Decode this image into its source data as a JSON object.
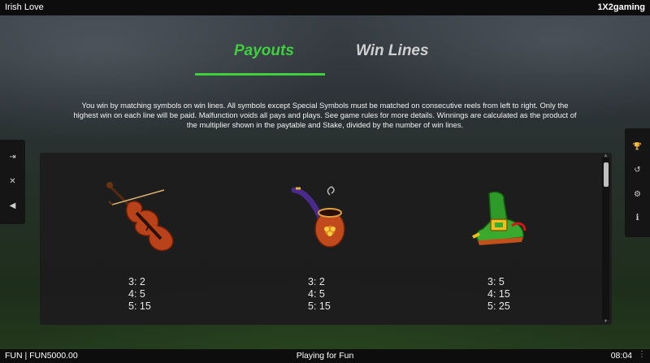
{
  "header": {
    "title": "Irish Love",
    "brand": "1X2gaming"
  },
  "tabs": [
    {
      "label": "Payouts",
      "active": true
    },
    {
      "label": "Win Lines",
      "active": false
    }
  ],
  "description": "You win by matching symbols on win lines. All symbols except Special Symbols must be matched on consecutive reels from left to right. Only the highest win on each line will be paid. Malfunction voids all pays and plays. See game rules for more details. Winnings are calculated as the product of the multiplier shown in the paytable and Stake, divided by the number of win lines.",
  "symbols": [
    {
      "icon": "violin-icon",
      "pays": [
        "3: 2",
        "4: 5",
        "5: 15"
      ]
    },
    {
      "icon": "pipe-icon",
      "pays": [
        "3: 2",
        "4: 5",
        "5: 15"
      ]
    },
    {
      "icon": "leprechaun-shoe-icon",
      "pays": [
        "3: 5",
        "4: 15",
        "5: 25"
      ]
    }
  ],
  "left_sidebar": [
    {
      "icon": "exit-icon",
      "glyph": "⇥"
    },
    {
      "icon": "close-icon",
      "glyph": "✕"
    },
    {
      "icon": "sound-icon",
      "glyph": "◀"
    }
  ],
  "right_sidebar": [
    {
      "icon": "trophy-icon",
      "glyph": "🏆"
    },
    {
      "icon": "history-icon",
      "glyph": "↺"
    },
    {
      "icon": "settings-gear-icon",
      "glyph": "⚙"
    },
    {
      "icon": "info-icon",
      "glyph": "i"
    }
  ],
  "footer": {
    "balance": "FUN | FUN5000.00",
    "mode": "Playing for Fun",
    "clock": "08:04",
    "more": "⋮"
  },
  "colors": {
    "accent": "#3fcf3f",
    "bar": "#0d0d0d",
    "panel": "#1c1c1c"
  }
}
